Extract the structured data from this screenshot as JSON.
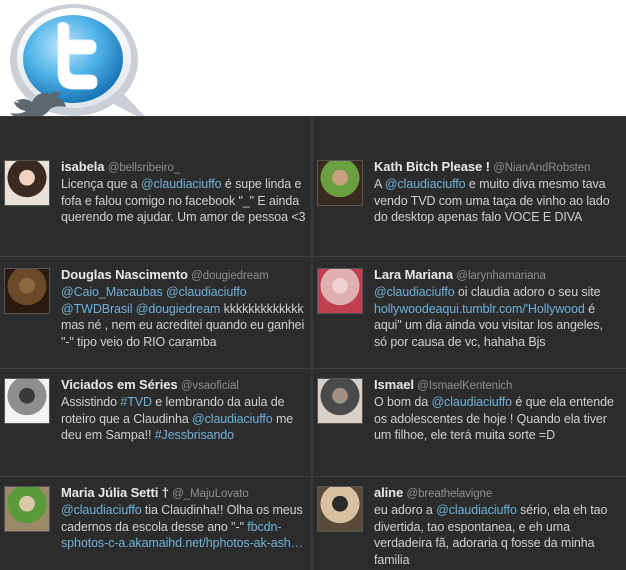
{
  "logo": {
    "icon": "twitter-bird-bubble-icon",
    "accent": "#3d9fd8"
  },
  "columns": [
    [
      {
        "name": "isabela",
        "handle": "@bellsribeiro_",
        "parts": [
          {
            "t": "Licença que a "
          },
          {
            "l": "@claudiaciuffo"
          },
          {
            "t": " é supe linda e fofa e falou comigo no facebook \"_\" E ainda querendo me ajudar. Um amor de pessoa <3"
          }
        ]
      },
      {
        "name": "Douglas Nascimento",
        "handle": "@dougiedream",
        "parts": [
          {
            "l": "@Caio_Macaubas"
          },
          {
            "t": " "
          },
          {
            "l": "@claudiaciuffo"
          },
          {
            "t": " "
          },
          {
            "l": "@TWDBrasil"
          },
          {
            "t": " "
          },
          {
            "l": "@dougiedream"
          },
          {
            "t": " kkkkkkkkkkkkk mas né , nem eu acreditei quando eu ganhei \"-\" tipo veio do RIO caramba"
          }
        ]
      },
      {
        "name": "Viciados em Séries",
        "handle": "@vsaoficial",
        "parts": [
          {
            "t": "Assistindo "
          },
          {
            "l": "#TVD"
          },
          {
            "t": " e lembrando da aula de roteiro que a Claudinha "
          },
          {
            "l": "@claudiaciuffo"
          },
          {
            "t": " me deu em Sampa!! "
          },
          {
            "l": "#Jessbrisando"
          }
        ]
      },
      {
        "name": "Maria Júlia Setti †",
        "handle": "@_MajuLovato",
        "parts": [
          {
            "l": "@claudiaciuffo"
          },
          {
            "t": " tia Claudinha!! Olha os meus cadernos da escola desse ano \"-\" "
          },
          {
            "l": "fbcdn-sphotos-c-a.akamaihd.net/hphotos-ak-ash…"
          }
        ]
      }
    ],
    [
      {
        "name": "Kath Bitch Please !",
        "handle": "@NianAndRobsten",
        "parts": [
          {
            "t": "A "
          },
          {
            "l": "@claudiaciuffo"
          },
          {
            "t": " e muito diva mesmo tava vendo TVD com uma taça de vinho ao lado do desktop apenas falo VOCE E DIVA"
          }
        ]
      },
      {
        "name": "Lara Mariana",
        "handle": "@larynhamariana",
        "parts": [
          {
            "l": "@claudiaciuffo"
          },
          {
            "t": " oi claudia adoro o seu site "
          },
          {
            "l": "hollywoodeaqui.tumblr.com/'Hollywood"
          },
          {
            "t": " é aqui\" um dia ainda vou visitar los angeles, só por causa de vc, hahaha Bjs"
          }
        ]
      },
      {
        "name": "Ismael",
        "handle": "@IsmaelKentenich",
        "parts": [
          {
            "t": "O bom da "
          },
          {
            "l": "@claudiaciuffo"
          },
          {
            "t": " é que ela entende os adolescentes de hoje ! Quando ela tiver um filhoe, ele terá muita sorte =D"
          }
        ]
      },
      {
        "name": "aline",
        "handle": "@breathelavigne",
        "parts": [
          {
            "t": "eu adoro a "
          },
          {
            "l": "@claudiaciuffo"
          },
          {
            "t": " sério, ela eh tao divertida, tao espontanea, e eh uma verdadeira fã, adoraria q fosse da minha familia"
          }
        ]
      }
    ]
  ]
}
